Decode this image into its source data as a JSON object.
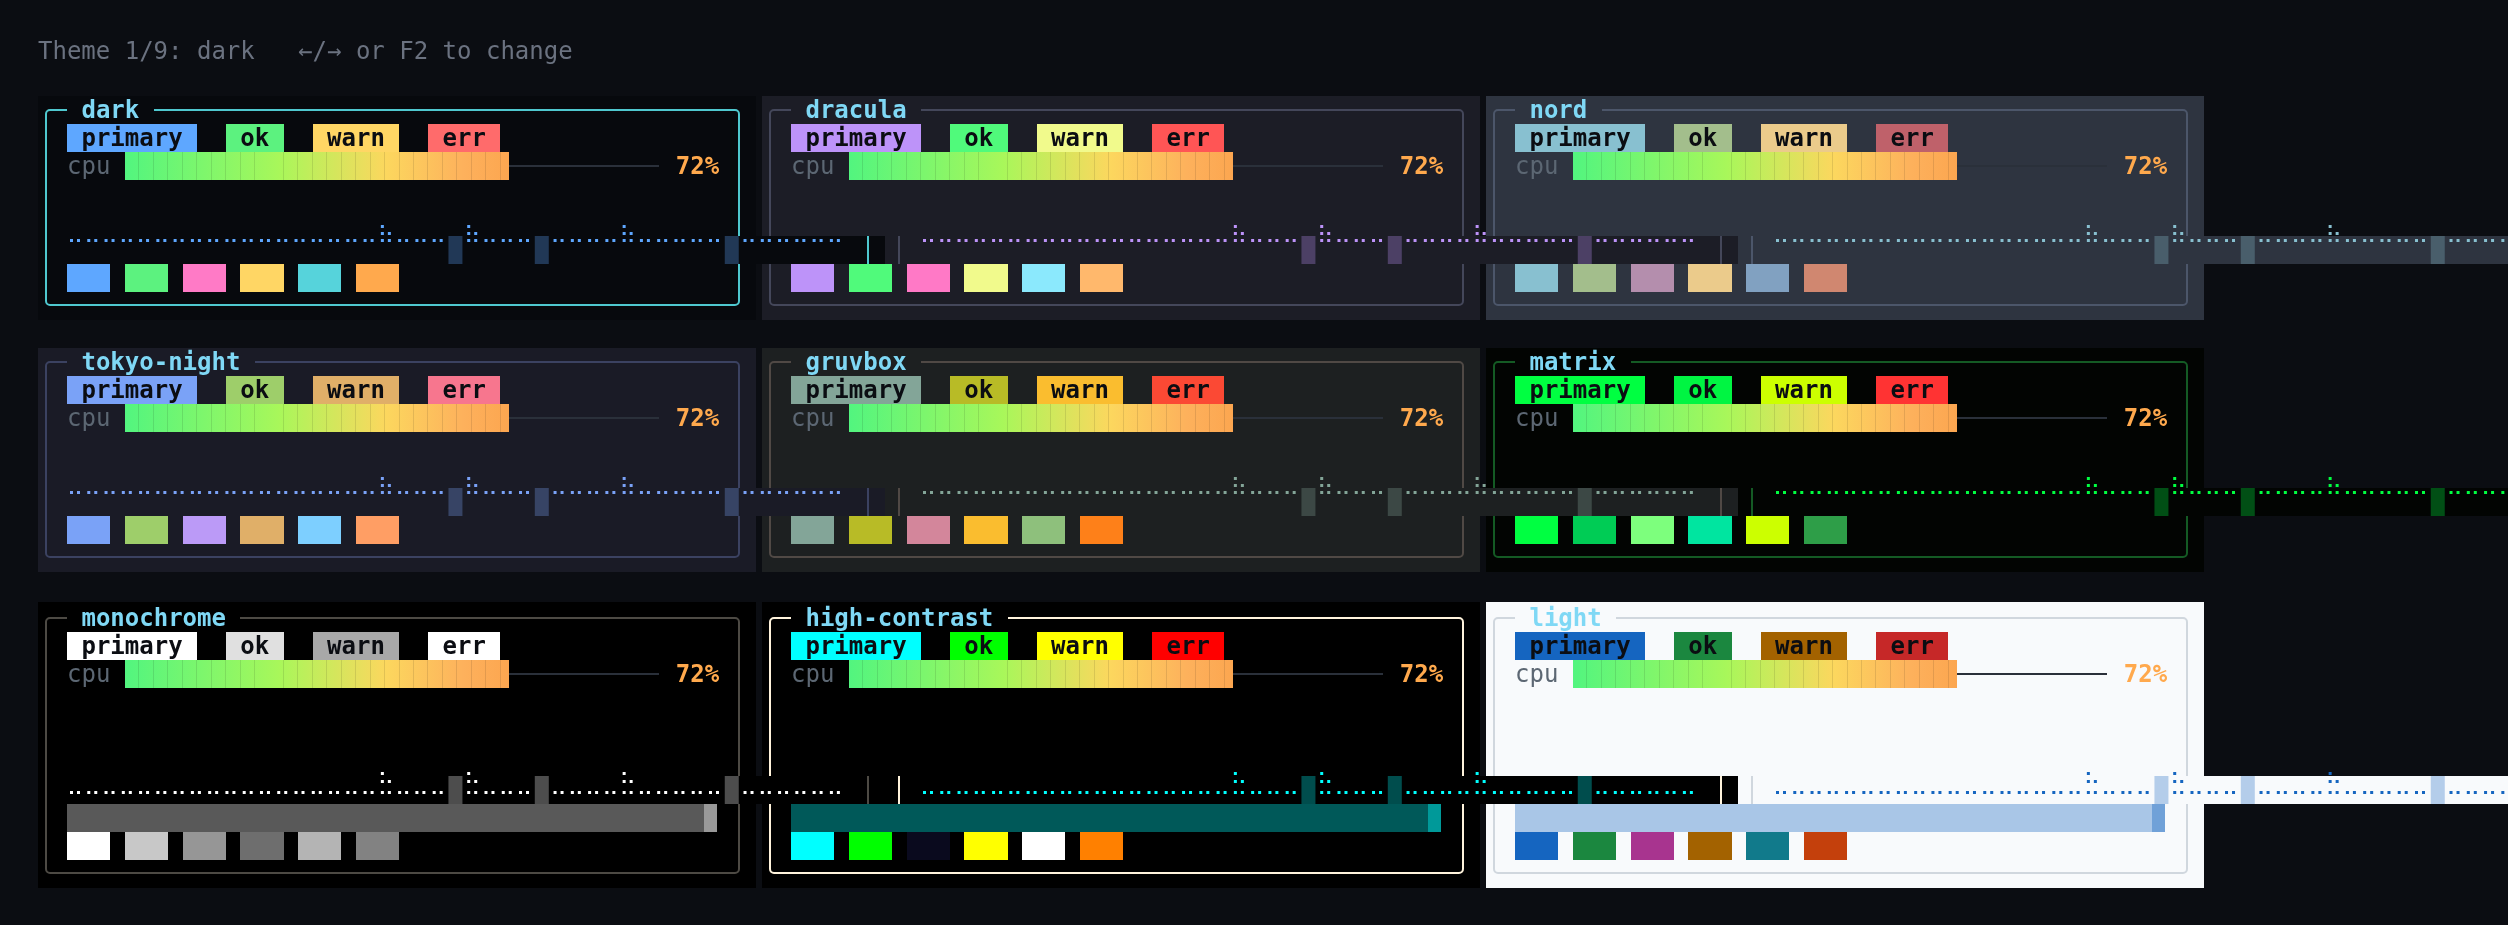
{
  "header": {
    "theme_label": "Theme 1/9: dark",
    "hint": "←/→ or F2 to change"
  },
  "themes": [
    {
      "name": "dark",
      "color": "#07090d",
      "frame": {
        "color": "#4fc8cf"
      },
      "badges": [
        {
          "label": "primary",
          "color": "#5ea7ff"
        },
        {
          "label": "ok",
          "color": "#5cf27f"
        },
        {
          "label": "warn",
          "color": "#ffd664"
        },
        {
          "label": "err",
          "color": "#ff6b6b"
        }
      ],
      "meter": {
        "label": "cpu",
        "level": 0.72,
        "reading": "72%"
      },
      "swatches": [
        {
          "color": "#5ea7ff"
        },
        {
          "color": "#5cf27f"
        },
        {
          "color": "#ff7ac6"
        },
        {
          "color": "#ffd664"
        },
        {
          "color": "#56d3db"
        },
        {
          "color": "#ffa94d"
        }
      ]
    },
    {
      "name": "dracula",
      "color": "#1c1d26",
      "frame": {
        "color": "#44475a"
      },
      "badges": [
        {
          "label": "primary",
          "color": "#bd93f9"
        },
        {
          "label": "ok",
          "color": "#50fa7b"
        },
        {
          "label": "warn",
          "color": "#f1fa8c"
        },
        {
          "label": "err",
          "color": "#ff5555"
        }
      ],
      "meter": {
        "label": "cpu",
        "level": 0.72,
        "reading": "72%"
      },
      "swatches": [
        {
          "color": "#bd93f9"
        },
        {
          "color": "#50fa7b"
        },
        {
          "color": "#ff79c6"
        },
        {
          "color": "#f1fa8c"
        },
        {
          "color": "#8be9fd"
        },
        {
          "color": "#ffb86c"
        }
      ]
    },
    {
      "name": "nord",
      "color": "#2e3440",
      "frame": {
        "color": "#4c566a"
      },
      "badges": [
        {
          "label": "primary",
          "color": "#88c0d0"
        },
        {
          "label": "ok",
          "color": "#a3be8c"
        },
        {
          "label": "warn",
          "color": "#ebcb8b"
        },
        {
          "label": "err",
          "color": "#bf616a"
        }
      ],
      "meter": {
        "label": "cpu",
        "level": 0.72,
        "reading": "72%"
      },
      "swatches": [
        {
          "color": "#88c0d0"
        },
        {
          "color": "#a3be8c"
        },
        {
          "color": "#b48ead"
        },
        {
          "color": "#ebcb8b"
        },
        {
          "color": "#81a1c1"
        },
        {
          "color": "#d08770"
        }
      ]
    },
    {
      "name": "tokyo-night",
      "color": "#1a1b26",
      "frame": {
        "color": "#3b4261"
      },
      "badges": [
        {
          "label": "primary",
          "color": "#7aa2f7"
        },
        {
          "label": "ok",
          "color": "#9ece6a"
        },
        {
          "label": "warn",
          "color": "#e0af68"
        },
        {
          "label": "err",
          "color": "#f7768e"
        }
      ],
      "meter": {
        "label": "cpu",
        "level": 0.72,
        "reading": "72%"
      },
      "swatches": [
        {
          "color": "#7aa2f7"
        },
        {
          "color": "#9ece6a"
        },
        {
          "color": "#bb9af7"
        },
        {
          "color": "#e0af68"
        },
        {
          "color": "#7dcfff"
        },
        {
          "color": "#ff9e64"
        }
      ]
    },
    {
      "name": "gruvbox",
      "color": "#1d2021",
      "frame": {
        "color": "#504945"
      },
      "badges": [
        {
          "label": "primary",
          "color": "#83a598"
        },
        {
          "label": "ok",
          "color": "#b8bb26"
        },
        {
          "label": "warn",
          "color": "#fabd2f"
        },
        {
          "label": "err",
          "color": "#fb4934"
        }
      ],
      "meter": {
        "label": "cpu",
        "level": 0.72,
        "reading": "72%"
      },
      "swatches": [
        {
          "color": "#83a598"
        },
        {
          "color": "#b8bb26"
        },
        {
          "color": "#d3869b"
        },
        {
          "color": "#fabd2f"
        },
        {
          "color": "#8ec07c"
        },
        {
          "color": "#fe8019"
        }
      ]
    },
    {
      "name": "matrix",
      "color": "#020402",
      "frame": {
        "color": "#145a24"
      },
      "badges": [
        {
          "label": "primary",
          "color": "#00ff41"
        },
        {
          "label": "ok",
          "color": "#00f542"
        },
        {
          "label": "warn",
          "color": "#ccff00"
        },
        {
          "label": "err",
          "color": "#ff3333"
        }
      ],
      "meter": {
        "label": "cpu",
        "level": 0.72,
        "reading": "72%"
      },
      "swatches": [
        {
          "color": "#00ff41"
        },
        {
          "color": "#00cc55"
        },
        {
          "color": "#7dff7d"
        },
        {
          "color": "#00e5a0"
        },
        {
          "color": "#ccff00"
        },
        {
          "color": "#2e9e48"
        }
      ]
    },
    {
      "name": "monochrome",
      "color": "#000000",
      "frame": {
        "color": "#4d4a44"
      },
      "shade_bar": true,
      "badges": [
        {
          "label": "primary",
          "color": "#ffffff"
        },
        {
          "label": "ok",
          "color": "#e0e0e0"
        },
        {
          "label": "warn",
          "color": "#a8a8a8"
        },
        {
          "label": "err",
          "color": "#ffffff"
        }
      ],
      "meter": {
        "label": "cpu",
        "level": 0.72,
        "reading": "72%"
      },
      "swatches": [
        {
          "color": "#ffffff"
        },
        {
          "color": "#c8c8c8"
        },
        {
          "color": "#969696"
        },
        {
          "color": "#6e6e6e"
        },
        {
          "color": "#b4b4b4"
        },
        {
          "color": "#828282"
        }
      ]
    },
    {
      "name": "high-contrast",
      "color": "#000000",
      "frame": {
        "color": "#fff3dc"
      },
      "shade_bar": true,
      "badges": [
        {
          "label": "primary",
          "color": "#00ffff"
        },
        {
          "label": "ok",
          "color": "#00ff00"
        },
        {
          "label": "warn",
          "color": "#ffff00"
        },
        {
          "label": "err",
          "color": "#ff0000"
        }
      ],
      "meter": {
        "label": "cpu",
        "level": 0.72,
        "reading": "72%"
      },
      "swatches": [
        {
          "color": "#00ffff"
        },
        {
          "color": "#00ff00"
        },
        {
          "color": "#0a0a1e"
        },
        {
          "color": "#ffff00"
        },
        {
          "color": "#ffffff"
        },
        {
          "color": "#ff8000"
        }
      ]
    },
    {
      "name": "light",
      "color": "#f8fafc",
      "frame": {
        "color": "#d0d7de"
      },
      "shade_bar": true,
      "badges": [
        {
          "label": "primary",
          "color": "#1565c0"
        },
        {
          "label": "ok",
          "color": "#1b873f"
        },
        {
          "label": "warn",
          "color": "#a36200"
        },
        {
          "label": "err",
          "color": "#c62828"
        }
      ],
      "meter": {
        "label": "cpu",
        "level": 0.72,
        "reading": "72%"
      },
      "swatches": [
        {
          "color": "#1565c0"
        },
        {
          "color": "#1b873f"
        },
        {
          "color": "#a8348f"
        },
        {
          "color": "#a36200"
        },
        {
          "color": "#117a8b"
        },
        {
          "color": "#c4400c"
        }
      ]
    }
  ]
}
